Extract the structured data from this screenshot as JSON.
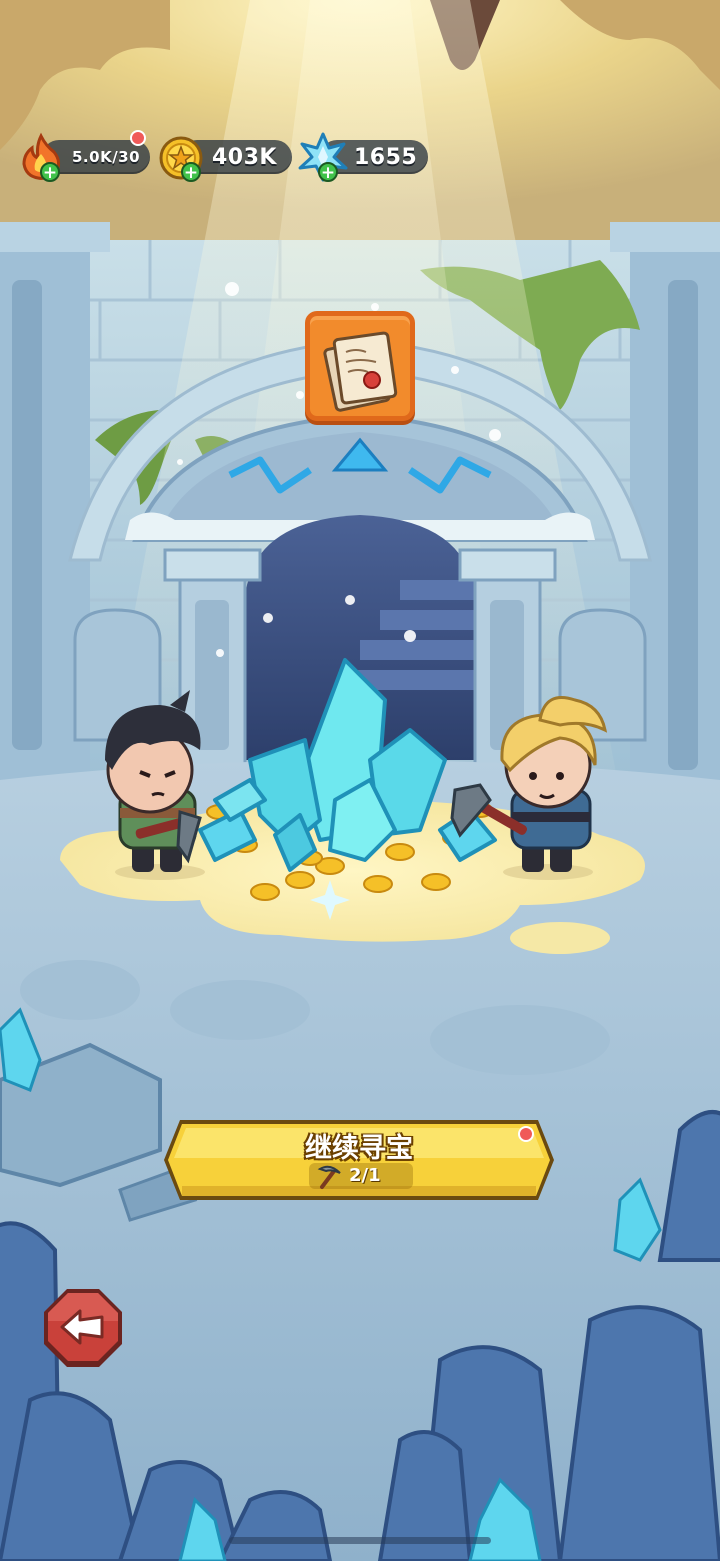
{
  "hud": {
    "energy": {
      "value": "5.0K/30",
      "icon": "flame-icon",
      "add_icon": "plus-icon"
    },
    "coins": {
      "value": "403K",
      "icon": "star-coin-icon",
      "add_icon": "plus-icon"
    },
    "gems": {
      "value": "1655",
      "icon": "crystal-icon",
      "add_icon": "plus-icon"
    }
  },
  "reward": {
    "icon": "scroll-letter-icon"
  },
  "scene": {
    "characters": [
      "miner-boy",
      "miner-girl"
    ],
    "treasure": "crystal-and-coin-pile"
  },
  "main_button": {
    "label": "继续寻宝",
    "cost": "2/1",
    "cost_icon": "pickaxe-icon"
  },
  "back_button": {
    "icon": "back-arrow-icon"
  },
  "colors": {
    "button_yellow": "#f7d13a",
    "reward_orange": "#f28b2c",
    "back_red": "#c9413a",
    "crystal": "#5fe0e8",
    "coin": "#f5c028"
  }
}
